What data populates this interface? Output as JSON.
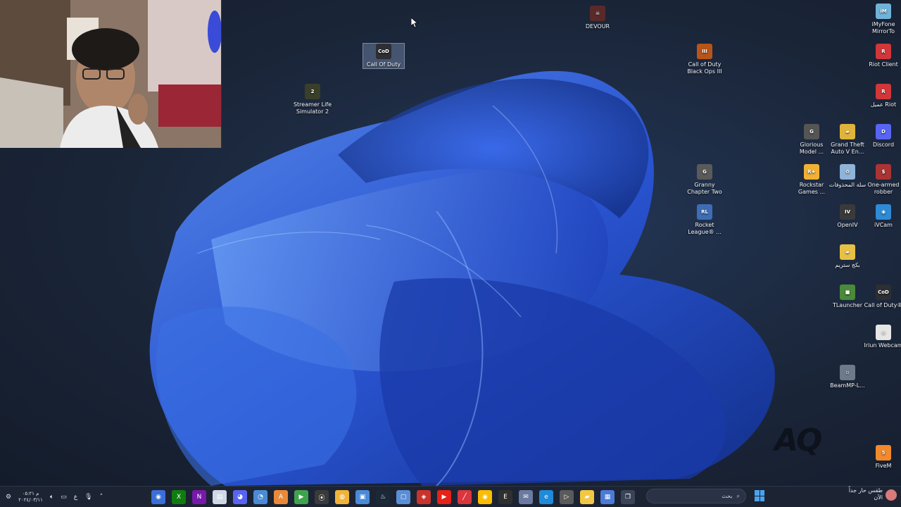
{
  "desktop_icons": [
    {
      "label": "DEVOUR",
      "color": "#5a2a2a",
      "glyph": "☠"
    },
    {
      "label": "Call Of Duty",
      "color": "#2d2f33",
      "glyph": "CoD",
      "selected": true
    },
    {
      "label": "Streamer Life Simulator 2",
      "color": "#3a3f2a",
      "glyph": "2"
    },
    {
      "label": "Call of Duty Black Ops III",
      "color": "#b8541a",
      "glyph": "III"
    },
    {
      "label": "iMyFone MirrorTo",
      "color": "#6fb3d9",
      "glyph": "iM"
    },
    {
      "label": "Riot Client",
      "color": "#d13639",
      "glyph": "R"
    },
    {
      "label": "عميل Riot",
      "color": "#d13639",
      "glyph": "R"
    },
    {
      "label": "Glorious Model ...",
      "color": "#555",
      "glyph": "G"
    },
    {
      "label": "Grand Theft Auto V En...",
      "color": "#e0b43a",
      "glyph": "▰"
    },
    {
      "label": "Discord",
      "color": "#5865f2",
      "glyph": "D"
    },
    {
      "label": "Granny Chapter Two",
      "color": "#5a5a5a",
      "glyph": "G"
    },
    {
      "label": "Rockstar Games ...",
      "color": "#f2b134",
      "glyph": "R★"
    },
    {
      "label": "سلة المحذوفات",
      "color": "#8fb3d9",
      "glyph": "♻"
    },
    {
      "label": "One-armed robber",
      "color": "#a33",
      "glyph": "$"
    },
    {
      "label": "Rocket League® ...",
      "color": "#3d6db5",
      "glyph": "RL"
    },
    {
      "label": "OpenIV",
      "color": "#3a3a3a",
      "glyph": "IV"
    },
    {
      "label": "iVCam",
      "color": "#2d8ad6",
      "glyph": "◉"
    },
    {
      "label": "بكج ستريم",
      "color": "#e8c046",
      "glyph": "▰"
    },
    {
      "label": "TLauncher",
      "color": "#4a8a3a",
      "glyph": "■"
    },
    {
      "label": "Call of Duty®",
      "color": "#2d2f33",
      "glyph": "CoD"
    },
    {
      "label": "Iriun Webcam",
      "color": "#e6e6e6",
      "glyph": "◎"
    },
    {
      "label": "BeamMP-L...",
      "color": "#6c7a8a",
      "glyph": "▫"
    },
    {
      "label": "FiveM",
      "color": "#f2892b",
      "glyph": "5"
    }
  ],
  "taskbar": {
    "clock_time": "م ٠٥:٢١",
    "clock_date": "٢٠٢٤/٠٣/١١",
    "tray_language": "ع",
    "search_placeholder": "بحث",
    "weather_line1": "طقس حار جداً",
    "weather_line2": "الآن",
    "apps": [
      {
        "name": "app-circle",
        "color": "#3b6fd8",
        "glyph": "◉"
      },
      {
        "name": "xbox",
        "color": "#107c10",
        "glyph": "X"
      },
      {
        "name": "onenote",
        "color": "#7719aa",
        "glyph": "N"
      },
      {
        "name": "notepad",
        "color": "#cfd8e6",
        "glyph": "▤"
      },
      {
        "name": "discord",
        "color": "#5865f2",
        "glyph": "◕"
      },
      {
        "name": "chrome-ext",
        "color": "#4b8bd6",
        "glyph": "◔"
      },
      {
        "name": "amd",
        "color": "#e98a3a",
        "glyph": "A"
      },
      {
        "name": "media-player",
        "color": "#3fa34d",
        "glyph": "▶"
      },
      {
        "name": "obs",
        "color": "#3a3a3a",
        "glyph": "⦿"
      },
      {
        "name": "norton",
        "color": "#f0b33a",
        "glyph": "◍"
      },
      {
        "name": "window-app",
        "color": "#4a8ad8",
        "glyph": "▣"
      },
      {
        "name": "steam",
        "color": "#1b2838",
        "glyph": "♨"
      },
      {
        "name": "window-app-2",
        "color": "#5a8ed6",
        "glyph": "▢"
      },
      {
        "name": "rockstar",
        "color": "#c8332b",
        "glyph": "◈"
      },
      {
        "name": "youtube",
        "color": "#e62117",
        "glyph": "▶"
      },
      {
        "name": "slash-app",
        "color": "#d9363e",
        "glyph": "╱"
      },
      {
        "name": "chrome",
        "color": "#fbbc05",
        "glyph": "◉"
      },
      {
        "name": "epic",
        "color": "#2f2f2f",
        "glyph": "E"
      },
      {
        "name": "mail",
        "color": "#6b7aa0",
        "glyph": "✉"
      },
      {
        "name": "edge",
        "color": "#1f8ad8",
        "glyph": "e"
      },
      {
        "name": "media",
        "color": "#5a5a5a",
        "glyph": "▷"
      },
      {
        "name": "file-explorer",
        "color": "#f2c744",
        "glyph": "▰"
      },
      {
        "name": "store",
        "color": "#4b7ad8",
        "glyph": "▦"
      },
      {
        "name": "task-view",
        "color": "#3a4458",
        "glyph": "❐"
      }
    ]
  }
}
